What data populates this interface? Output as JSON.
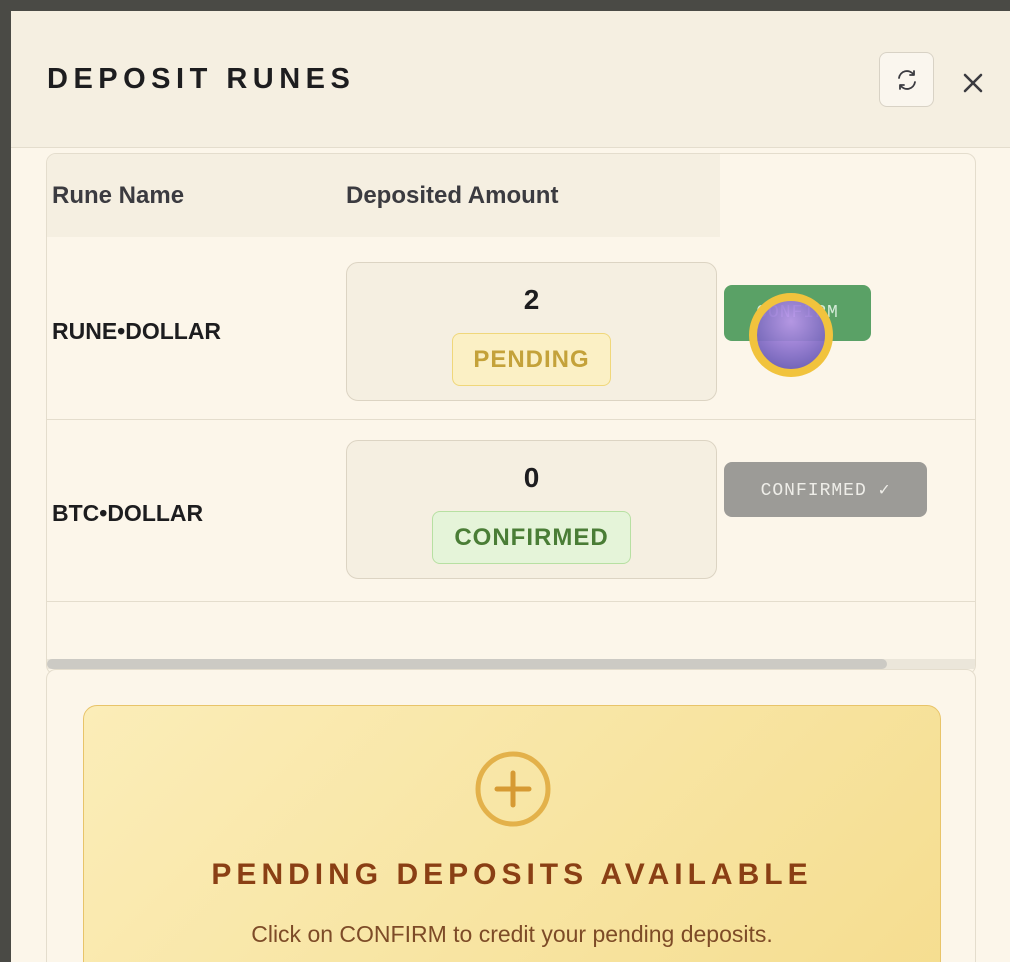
{
  "modal": {
    "title": "DEPOSIT RUNES",
    "refresh_icon": "refresh-icon",
    "close_icon": "close-icon"
  },
  "table": {
    "columns": [
      "Rune Name",
      "Deposited Amount"
    ],
    "rows": [
      {
        "name": "RUNE•DOLLAR",
        "amount": "2",
        "status": "PENDING",
        "action": "CONFIRM"
      },
      {
        "name": "BTC•DOLLAR",
        "amount": "0",
        "status": "CONFIRMED",
        "action": "CONFIRMED ✓"
      }
    ]
  },
  "pending_panel": {
    "icon": "plus-circle-icon",
    "title": "PENDING DEPOSITS AVAILABLE",
    "text": "Click on CONFIRM to credit your pending deposits."
  },
  "colors": {
    "modal_bg": "#fcf6ea",
    "confirm_green": "#5aa166",
    "pending_yellow": "#c4a23a",
    "confirmed_green": "#4a7d36",
    "title_brown": "#8a3f14",
    "cursor_ring": "#f1c33d"
  }
}
